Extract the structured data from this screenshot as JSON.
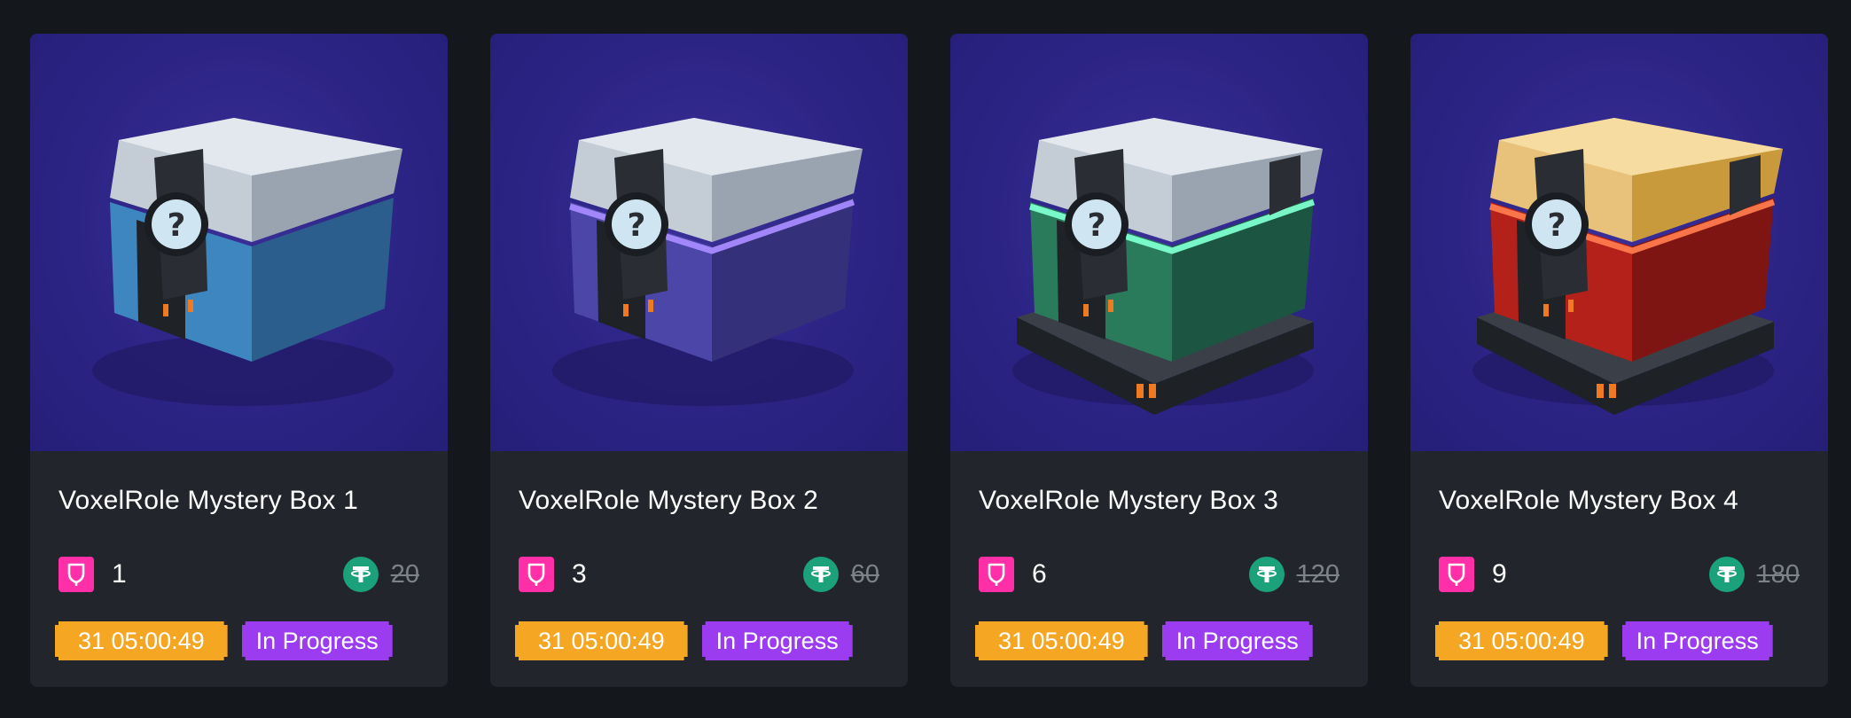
{
  "colors": {
    "page_bg": "#14171c",
    "card_bg": "#22252b",
    "art_bg": "#2c2485",
    "gem": "#ff2fa8",
    "tether": "#1ba27a",
    "timer": "#f5a623",
    "status": "#9b3cf0"
  },
  "cards": [
    {
      "title": "VoxelRole Mystery Box 1",
      "gem_icon": "gem-icon",
      "quantity": "1",
      "currency_icon": "tether-icon",
      "old_price": "20",
      "timer": "31 05:00:49",
      "status": "In Progress",
      "box_icon": "blue-mystery-box",
      "box_colors": {
        "body": "#3d86c0",
        "dark": "#2b5e8c",
        "glow": ""
      }
    },
    {
      "title": "VoxelRole Mystery Box 2",
      "gem_icon": "gem-icon",
      "quantity": "3",
      "currency_icon": "tether-icon",
      "old_price": "60",
      "timer": "31 05:00:49",
      "status": "In Progress",
      "box_icon": "purple-mystery-box",
      "box_colors": {
        "body": "#4b46a8",
        "dark": "#343079",
        "glow": "#a78bff"
      }
    },
    {
      "title": "VoxelRole Mystery Box 3",
      "gem_icon": "gem-icon",
      "quantity": "6",
      "currency_icon": "tether-icon",
      "old_price": "120",
      "timer": "31 05:00:49",
      "status": "In Progress",
      "box_icon": "green-mystery-box",
      "box_colors": {
        "body": "#2a7a5c",
        "dark": "#1c5542",
        "glow": "#7dffd0"
      }
    },
    {
      "title": "VoxelRole Mystery Box 4",
      "gem_icon": "gem-icon",
      "quantity": "9",
      "currency_icon": "tether-icon",
      "old_price": "180",
      "timer": "31 05:00:49",
      "status": "In Progress",
      "box_icon": "red-gold-mystery-box",
      "box_colors": {
        "body": "#b4201a",
        "dark": "#7e1512",
        "glow": "#ff7a4d"
      }
    }
  ]
}
